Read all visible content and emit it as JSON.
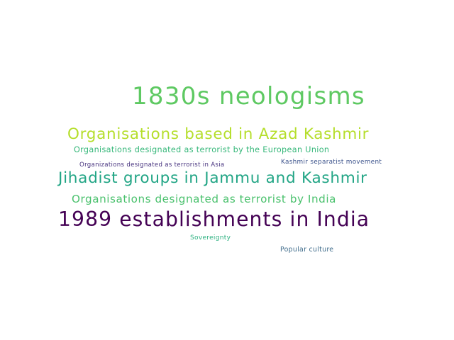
{
  "wordcloud": {
    "words": [
      {
        "text": "1830s neologisms",
        "color": "#5ec962"
      },
      {
        "text": "Organisations based in Azad Kashmir",
        "color": "#b5de2b"
      },
      {
        "text": "Organisations designated as terrorist by the European Union",
        "color": "#35b779"
      },
      {
        "text": "Organizations designated as terrorist in Asia",
        "color": "#46327e"
      },
      {
        "text": "Kashmir separatist movement",
        "color": "#3b528b"
      },
      {
        "text": "Jihadist groups in Jammu and Kashmir",
        "color": "#21a585"
      },
      {
        "text": "Organisations designated as terrorist by India",
        "color": "#4ac16d"
      },
      {
        "text": "1989 establishments in India",
        "color": "#440154"
      },
      {
        "text": "Sovereignty",
        "color": "#2ab07f"
      },
      {
        "text": "Popular culture",
        "color": "#3e6b8a"
      }
    ]
  }
}
